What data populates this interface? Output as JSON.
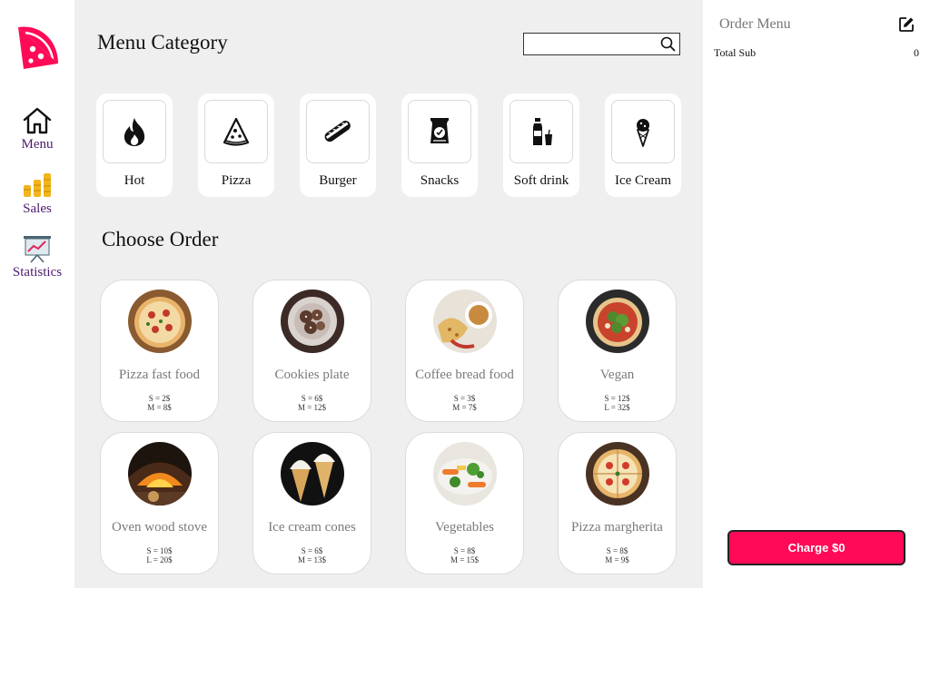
{
  "sidebar": {
    "items": [
      {
        "label": "Menu",
        "icon": "home-icon"
      },
      {
        "label": "Sales",
        "icon": "coins-chart-icon"
      },
      {
        "label": "Statistics",
        "icon": "presentation-chart-icon"
      }
    ]
  },
  "main": {
    "category_title": "Menu Category",
    "search": {
      "value": "",
      "placeholder": ""
    },
    "categories": [
      {
        "label": "Hot",
        "icon": "flame-icon"
      },
      {
        "label": "Pizza",
        "icon": "pizza-slice-icon"
      },
      {
        "label": "Burger",
        "icon": "sandwich-icon"
      },
      {
        "label": "Snacks",
        "icon": "chips-bag-icon"
      },
      {
        "label": "Soft drink",
        "icon": "bottle-cup-icon"
      },
      {
        "label": "Ice Cream",
        "icon": "ice-cream-cone-icon"
      }
    ],
    "order_title": "Choose Order",
    "foods": [
      {
        "name": "Pizza fast food",
        "price1": "S = 2$",
        "price2": "M = 8$"
      },
      {
        "name": "Cookies plate",
        "price1": "S = 6$",
        "price2": "M = 12$"
      },
      {
        "name": "Coffee bread food",
        "price1": "S = 3$",
        "price2": "M = 7$"
      },
      {
        "name": "Vegan",
        "price1": "S = 12$",
        "price2": "L = 32$"
      },
      {
        "name": "Oven wood stove",
        "price1": "S = 10$",
        "price2": "L = 20$"
      },
      {
        "name": "Ice cream cones",
        "price1": "S = 6$",
        "price2": "M = 13$"
      },
      {
        "name": "Vegetables",
        "price1": "S = 8$",
        "price2": "M = 15$"
      },
      {
        "name": "Pizza margherita",
        "price1": "S = 8$",
        "price2": "M = 9$"
      }
    ]
  },
  "order": {
    "title": "Order Menu",
    "total_label": "Total Sub",
    "total_value": "0",
    "charge_label": "Charge $0"
  },
  "colors": {
    "brand": "#ff0a56",
    "nav_text": "#4b1a6e",
    "panel_bg": "#efefef",
    "coins": "#f2b51d"
  }
}
